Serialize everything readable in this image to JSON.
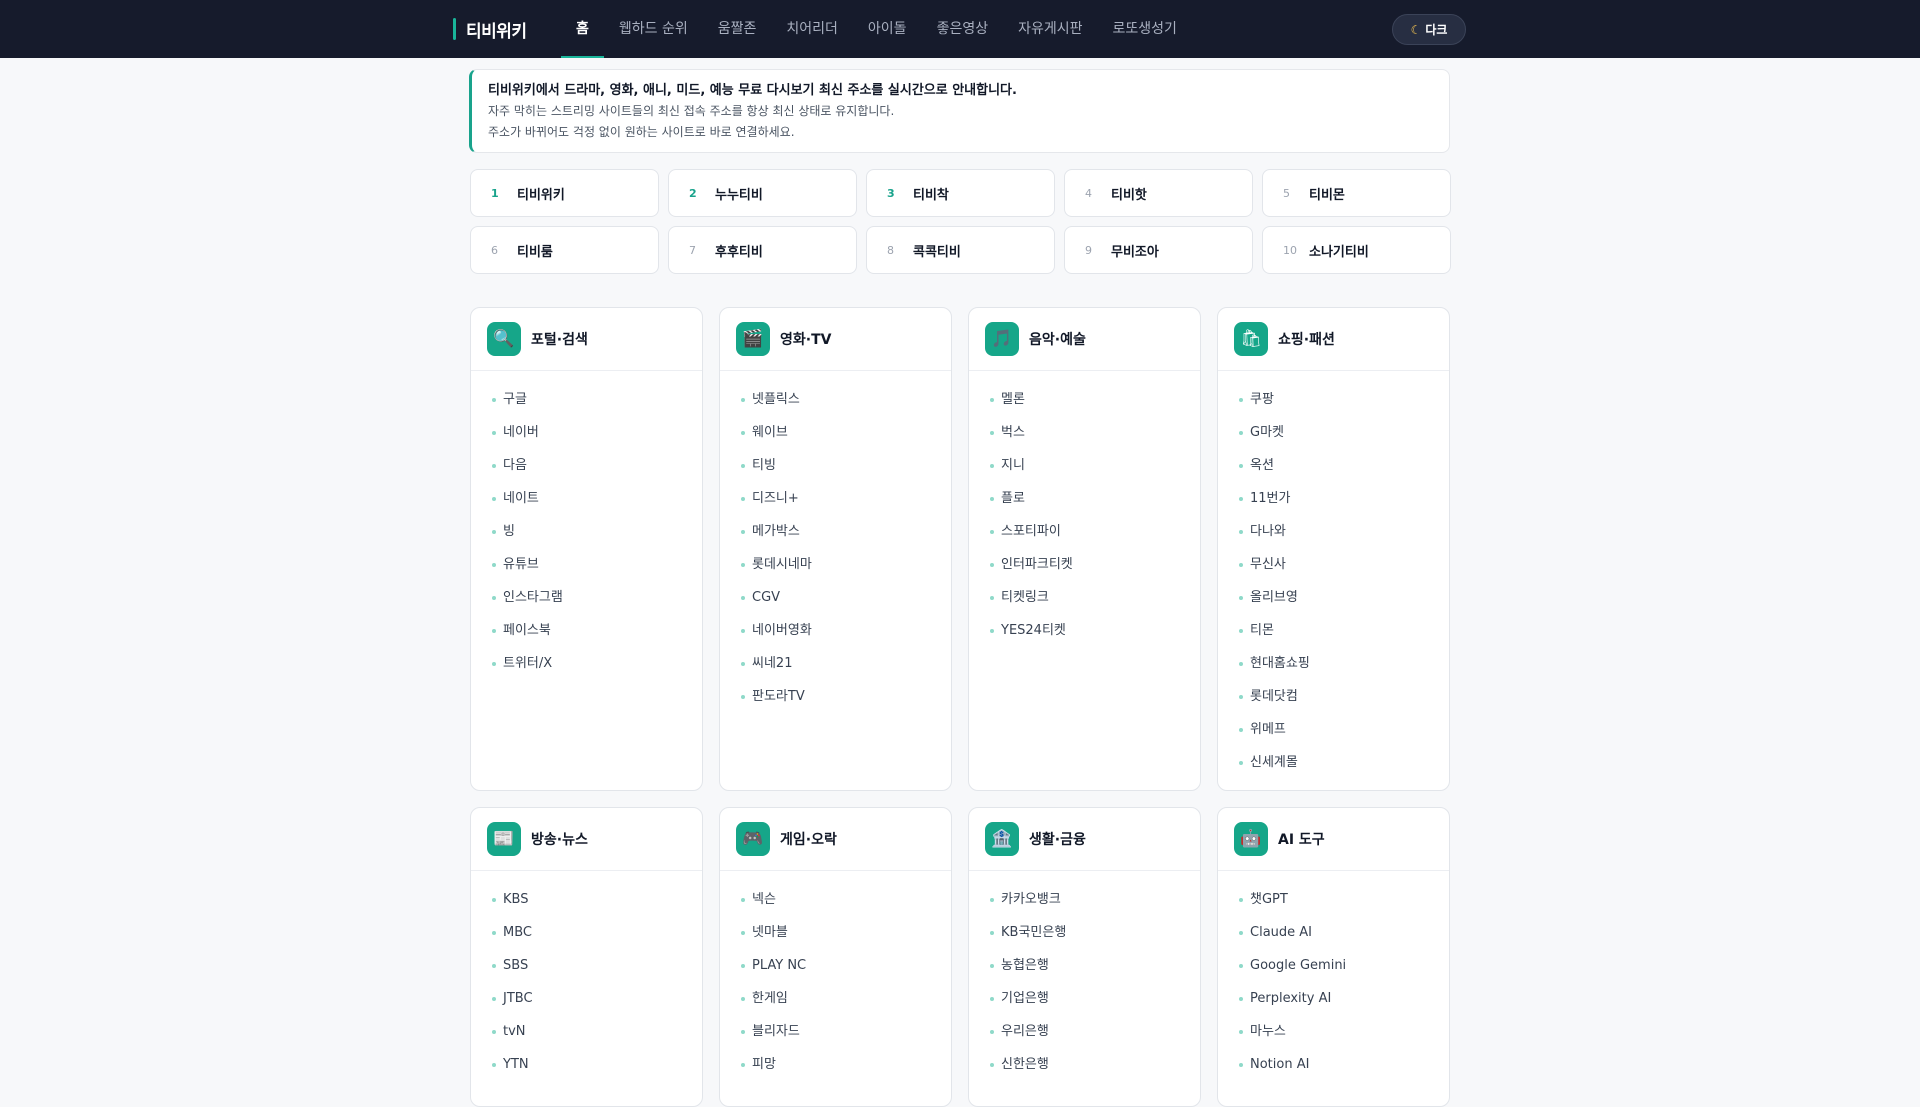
{
  "header": {
    "logo": "티비위키",
    "nav": [
      "홈",
      "웹하드 순위",
      "움짤존",
      "치어리더",
      "아이돌",
      "좋은영상",
      "자유게시판",
      "로또생성기"
    ],
    "theme_button": "다크",
    "theme_icon": "moon-icon"
  },
  "notice": {
    "title": "티비위키에서 드라마, 영화, 애니, 미드, 예능 무료 다시보기 최신 주소를 실시간으로 안내합니다.",
    "line1": "자주 막히는 스트리밍 사이트들의 최신 접속 주소를 항상 최신 상태로 유지합니다.",
    "line2": "주소가 바뀌어도 걱정 없이 원하는 사이트로 바로 연결하세요."
  },
  "ranks": [
    {
      "num": "1",
      "name": "티비위키"
    },
    {
      "num": "2",
      "name": "누누티비"
    },
    {
      "num": "3",
      "name": "티비착"
    },
    {
      "num": "4",
      "name": "티비핫"
    },
    {
      "num": "5",
      "name": "티비몬"
    },
    {
      "num": "6",
      "name": "티비룸"
    },
    {
      "num": "7",
      "name": "후후티비"
    },
    {
      "num": "8",
      "name": "콕콕티비"
    },
    {
      "num": "9",
      "name": "무비조아"
    },
    {
      "num": "10",
      "name": "소나기티비"
    }
  ],
  "categories": [
    {
      "title": "포털·검색",
      "icon": "🔍",
      "links": [
        "구글",
        "네이버",
        "다음",
        "네이트",
        "빙",
        "유튜브",
        "인스타그램",
        "페이스북",
        "트위터/X"
      ]
    },
    {
      "title": "영화·TV",
      "icon": "🎬",
      "links": [
        "넷플릭스",
        "웨이브",
        "티빙",
        "디즈니+",
        "메가박스",
        "롯데시네마",
        "CGV",
        "네이버영화",
        "씨네21",
        "판도라TV"
      ]
    },
    {
      "title": "음악·예술",
      "icon": "🎵",
      "links": [
        "멜론",
        "벅스",
        "지니",
        "플로",
        "스포티파이",
        "인터파크티켓",
        "티켓링크",
        "YES24티켓"
      ]
    },
    {
      "title": "쇼핑·패션",
      "icon": "🛍",
      "links": [
        "쿠팡",
        "G마켓",
        "옥션",
        "11번가",
        "다나와",
        "무신사",
        "올리브영",
        "티몬",
        "현대홈쇼핑",
        "롯데닷컴",
        "위메프",
        "신세계몰"
      ]
    },
    {
      "title": "방송·뉴스",
      "icon": "📰",
      "links": [
        "KBS",
        "MBC",
        "SBS",
        "JTBC",
        "tvN",
        "YTN"
      ]
    },
    {
      "title": "게임·오락",
      "icon": "🎮",
      "links": [
        "넥슨",
        "넷마블",
        "PLAY NC",
        "한게임",
        "블리자드",
        "피망"
      ]
    },
    {
      "title": "생활·금융",
      "icon": "🏦",
      "links": [
        "카카오뱅크",
        "KB국민은행",
        "농협은행",
        "기업은행",
        "우리은행",
        "신한은행"
      ]
    },
    {
      "title": "AI 도구",
      "icon": "🤖",
      "links": [
        "챗GPT",
        "Claude AI",
        "Google Gemini",
        "Perplexity AI",
        "마누스",
        "Notion AI"
      ]
    }
  ],
  "category_icon_names": [
    "search-icon",
    "clapperboard-icon",
    "music-note-icon",
    "shopping-bag-icon",
    "newspaper-icon",
    "gamepad-icon",
    "bank-icon",
    "robot-icon"
  ],
  "colors": {
    "accent": "#19a38c",
    "header_bg": "#161b2c",
    "page_bg": "#f7f8fa"
  }
}
